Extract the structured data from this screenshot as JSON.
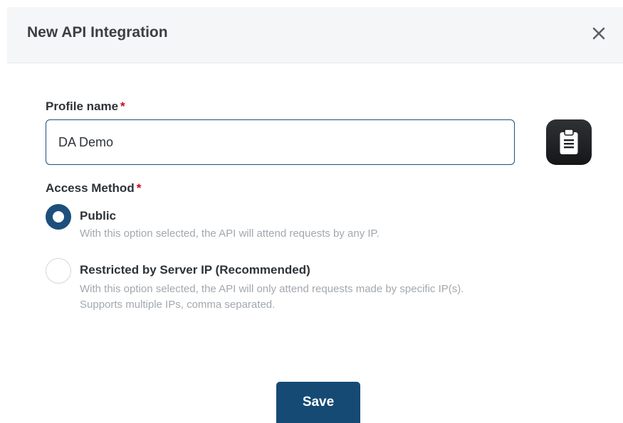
{
  "dialog": {
    "title": "New API Integration"
  },
  "profile": {
    "label": "Profile name",
    "required_mark": "*",
    "value": "DA Demo"
  },
  "access": {
    "label": "Access Method",
    "required_mark": "*",
    "options": [
      {
        "label": "Public",
        "description": "With this option selected, the API will attend requests by any IP.",
        "selected": true
      },
      {
        "label": "Restricted by Server IP (Recommended)",
        "description_line1": "With this option selected, the API will only attend requests made by specific IP(s).",
        "description_line2": "Supports multiple IPs, comma separated.",
        "selected": false
      }
    ]
  },
  "footer": {
    "save_label": "Save"
  },
  "colors": {
    "primary": "#1d4f7c",
    "required": "#d0021b",
    "muted": "#a2a8ae"
  },
  "icons": {
    "close": "close-icon",
    "clipboard": "clipboard-icon"
  }
}
